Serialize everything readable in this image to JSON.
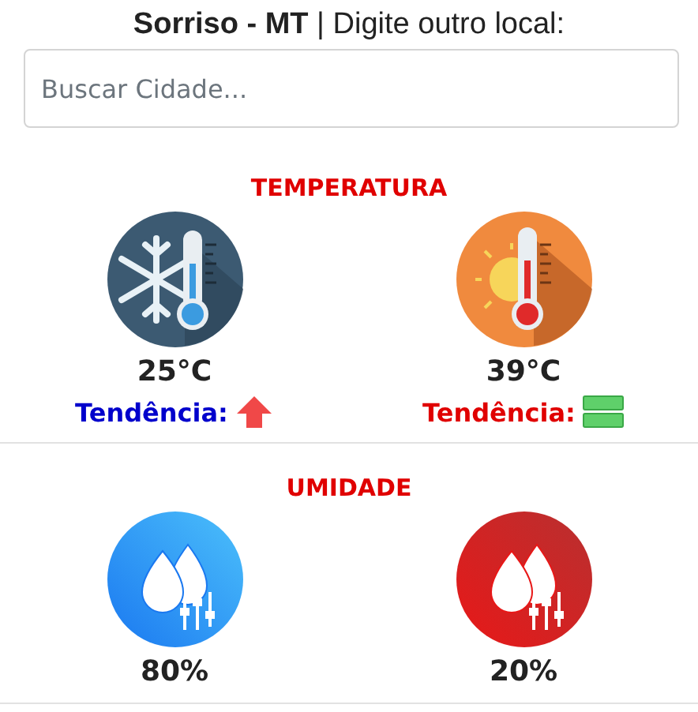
{
  "header": {
    "city": "Sorriso - MT",
    "separator": "|",
    "prompt": "Digite outro local:"
  },
  "search": {
    "placeholder": "Buscar Cidade..."
  },
  "sections": [
    {
      "title": "TEMPERATURA",
      "items": [
        {
          "kind": "cold",
          "value": "25°C",
          "trend": {
            "label": "Tendência:",
            "color": "#0000cc",
            "kind": "up"
          }
        },
        {
          "kind": "hot",
          "value": "39°C",
          "trend": {
            "label": "Tendência:",
            "color": "#e00000",
            "kind": "stable"
          }
        }
      ]
    },
    {
      "title": "UMIDADE",
      "items": [
        {
          "kind": "humid",
          "value": "80%"
        },
        {
          "kind": "dry",
          "value": "20%"
        }
      ]
    }
  ]
}
